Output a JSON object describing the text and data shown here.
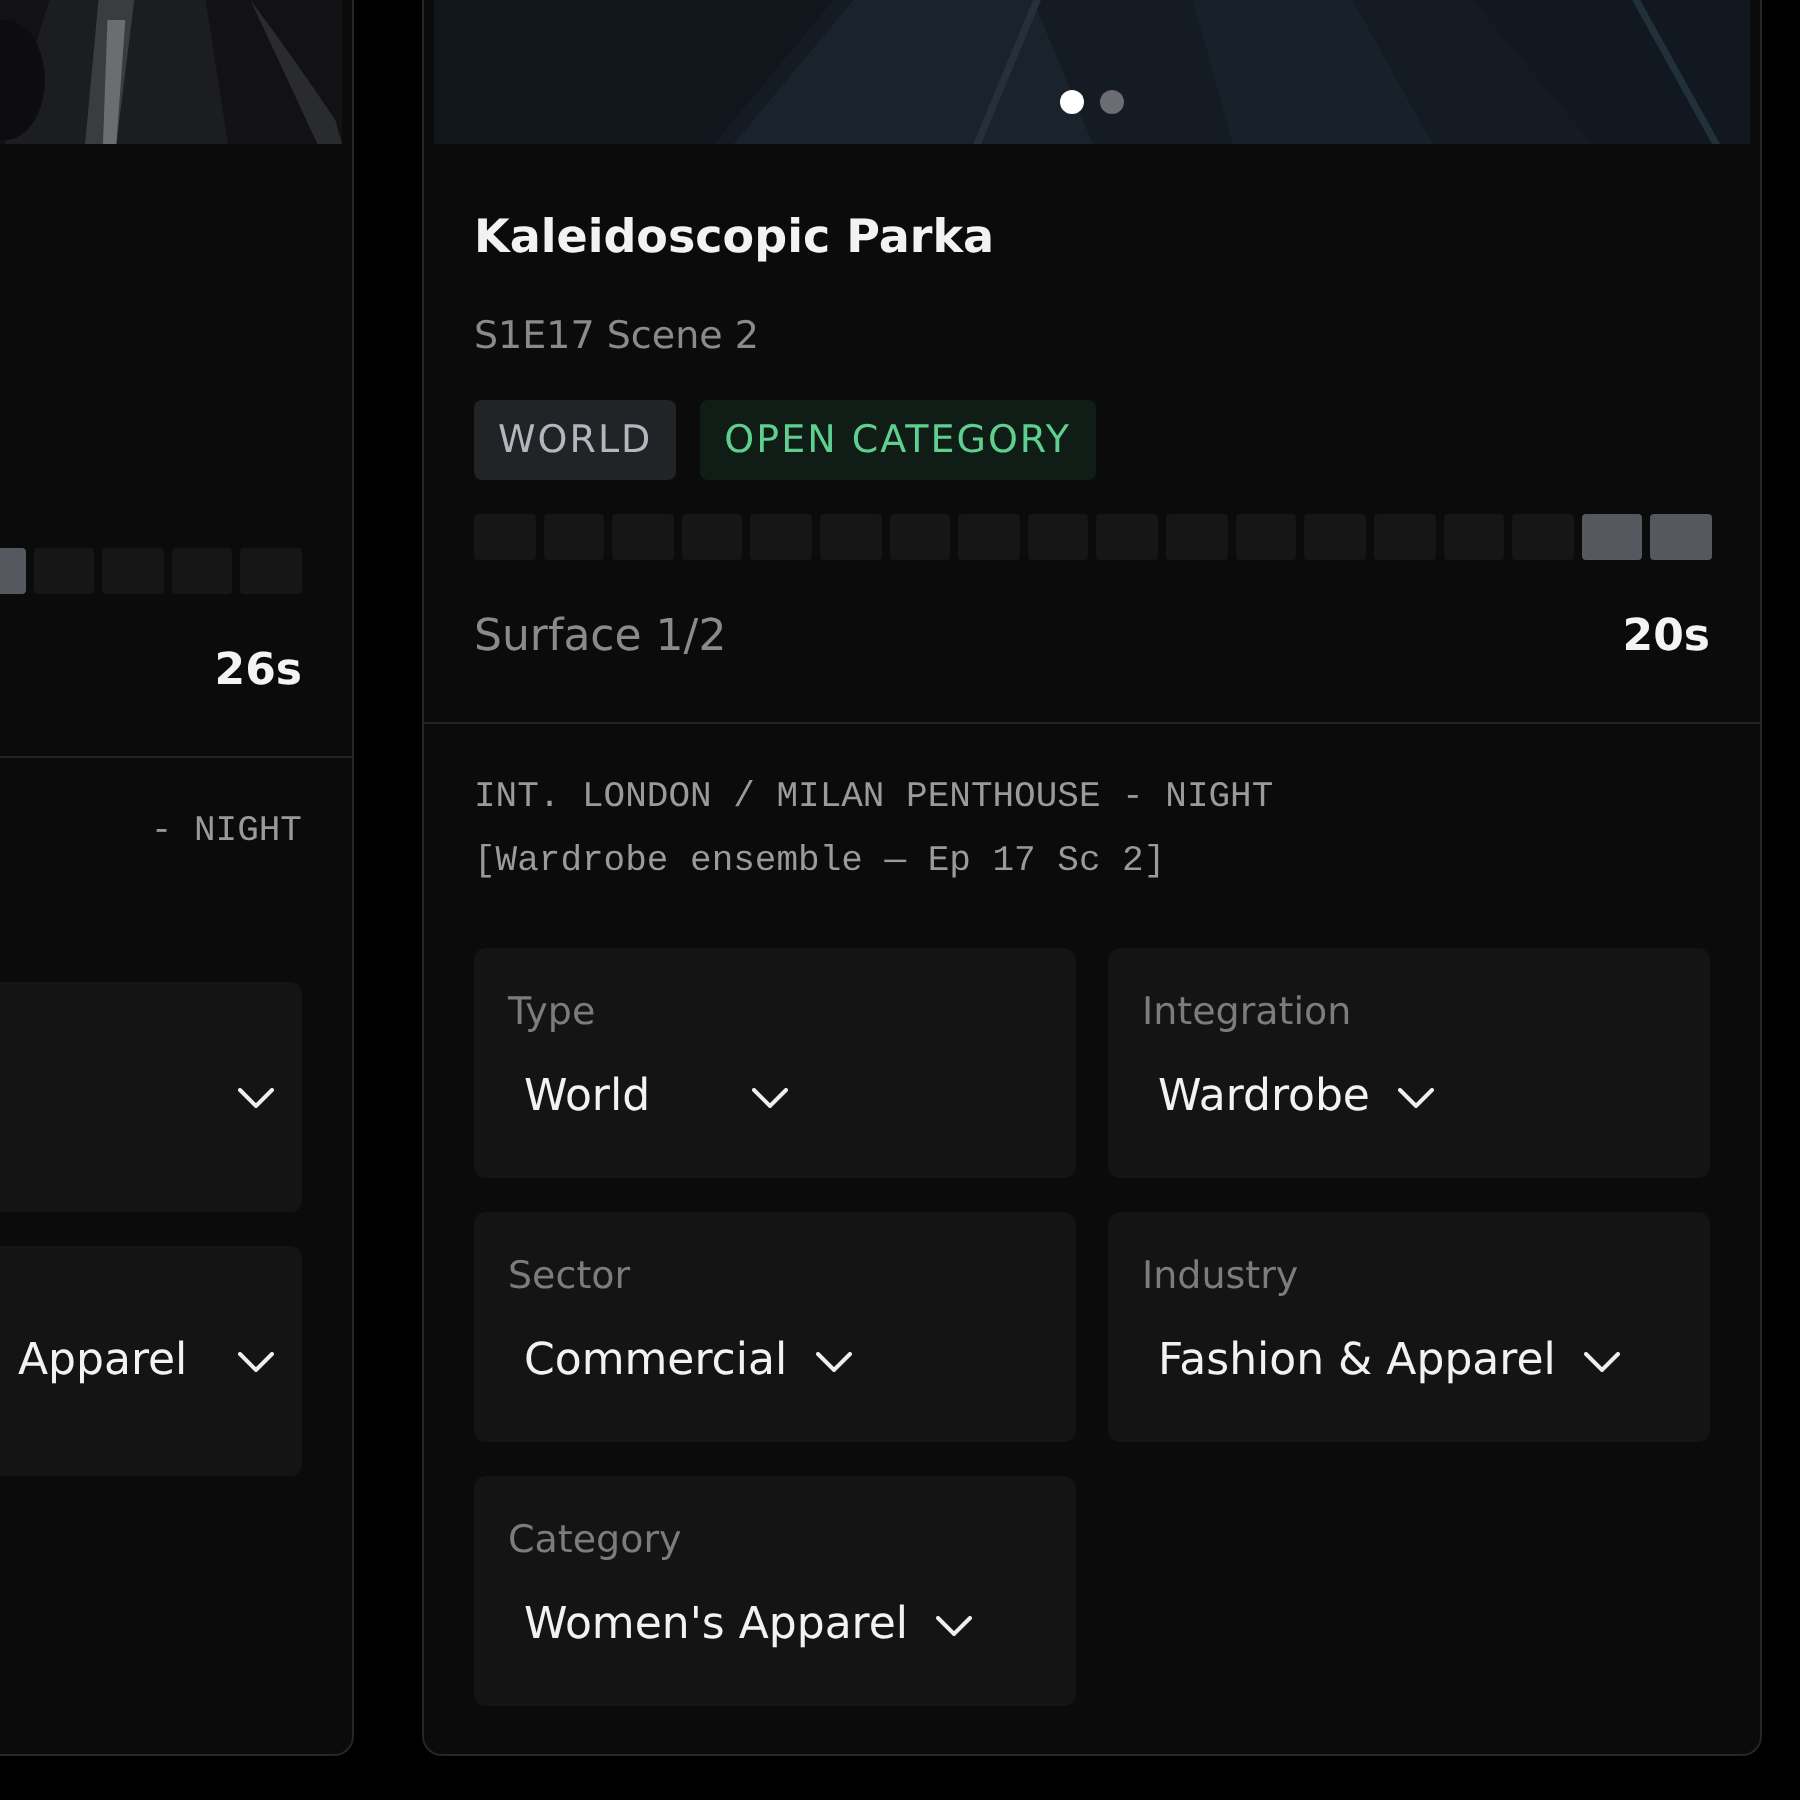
{
  "left_card": {
    "segments": [
      {
        "filled": true
      },
      {
        "filled": false
      },
      {
        "filled": false
      },
      {
        "filled": false
      },
      {
        "filled": false
      }
    ],
    "duration": "26s",
    "slug_line": "- NIGHT",
    "fields": [
      {
        "kind": "select"
      },
      {
        "kind": "select",
        "value": "Apparel"
      }
    ]
  },
  "card": {
    "dots": [
      {
        "selected": true
      },
      {
        "selected": false
      }
    ],
    "title": "Kaleidoscopic Parka",
    "subtitle": "S1E17 Scene 2",
    "tags": [
      {
        "label": "WORLD",
        "kind": "neutral"
      },
      {
        "label": "OPEN CATEGORY",
        "kind": "success"
      }
    ],
    "segments": [
      {
        "filled": false
      },
      {
        "filled": false
      },
      {
        "filled": false
      },
      {
        "filled": false
      },
      {
        "filled": false
      },
      {
        "filled": false
      },
      {
        "filled": false
      },
      {
        "filled": false
      },
      {
        "filled": false
      },
      {
        "filled": false
      },
      {
        "filled": false
      },
      {
        "filled": false
      },
      {
        "filled": false
      },
      {
        "filled": false
      },
      {
        "filled": false
      },
      {
        "filled": false
      },
      {
        "filled": true
      },
      {
        "filled": true
      }
    ],
    "surface": "Surface 1/2",
    "duration": "20s",
    "slug_line": "INT. LONDON / MILAN PENTHOUSE - NIGHT",
    "note": "[Wardrobe ensemble — Ep 17 Sc 2]",
    "fields": [
      {
        "kind": "select",
        "label": "Type",
        "value": "World"
      },
      {
        "kind": "select",
        "label": "Integration",
        "value": "Wardrobe"
      },
      {
        "kind": "select",
        "label": "Sector",
        "value": "Commercial"
      },
      {
        "kind": "select",
        "label": "Industry",
        "value": "Fashion & Apparel"
      },
      {
        "kind": "select",
        "label": "Category",
        "value": "Women's Apparel"
      }
    ]
  }
}
